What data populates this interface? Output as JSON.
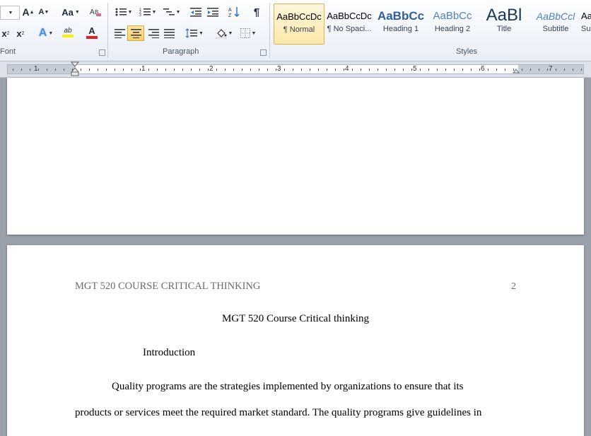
{
  "ribbon": {
    "groups": {
      "font": "Font",
      "paragraph": "Paragraph",
      "styles": "Styles"
    },
    "font": {
      "grow_label": "A",
      "shrink_label": "A",
      "case_label": "Aa",
      "subscript_label": "x",
      "superscript_label": "x",
      "effects_label": "A",
      "highlight_label": "ab",
      "color_label": "A"
    },
    "paragraph": {
      "pilcrow_label": "¶"
    },
    "styles": [
      {
        "preview": "AaBbCcDc",
        "name": "¶ Normal"
      },
      {
        "preview": "AaBbCcDc",
        "name": "¶ No Spaci..."
      },
      {
        "preview": "AaBbCc",
        "name": "Heading 1"
      },
      {
        "preview": "AaBbCc",
        "name": "Heading 2"
      },
      {
        "preview": "AaBl",
        "name": "Title"
      },
      {
        "preview": "AaBbCcl",
        "name": "Subtitle"
      },
      {
        "preview": "Aa",
        "name": "Su"
      }
    ]
  },
  "ruler": {
    "numbers": [
      "1",
      "1",
      "2",
      "3",
      "4",
      "5",
      "6",
      "7"
    ]
  },
  "document": {
    "header_title": "MGT 520 COURSE CRITICAL THINKING",
    "header_page": "2",
    "title": "MGT 520 Course Critical thinking",
    "intro_heading": "Introduction",
    "para1_line1": "Quality programs are the strategies implemented by organizations to ensure that its",
    "para1_line2": "products or services meet the required market standard. The quality programs give guidelines in"
  },
  "colors": {
    "accent_selected_style": "#e3b14c",
    "font_color_bar": "#e02020",
    "highlight_bar": "#ffef00"
  }
}
